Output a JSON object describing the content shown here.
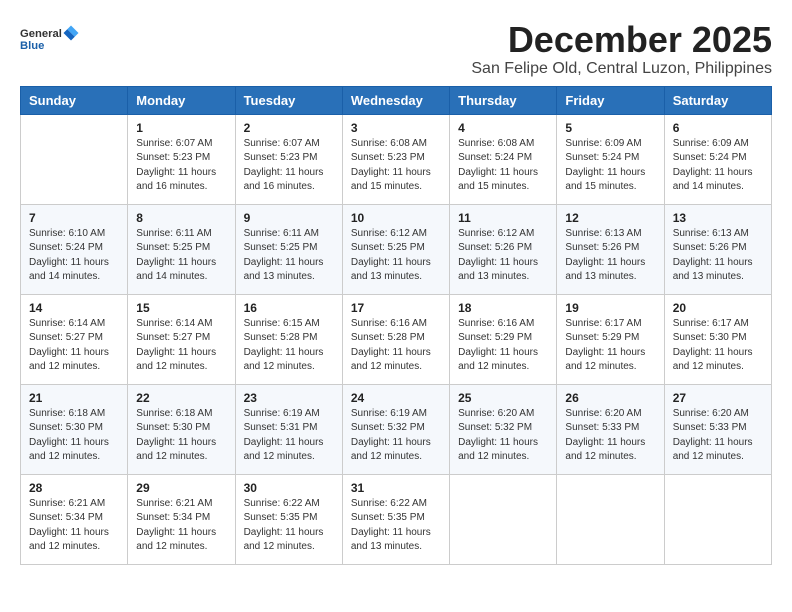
{
  "header": {
    "logo_line1": "General",
    "logo_line2": "Blue",
    "month": "December 2025",
    "location": "San Felipe Old, Central Luzon, Philippines"
  },
  "weekdays": [
    "Sunday",
    "Monday",
    "Tuesday",
    "Wednesday",
    "Thursday",
    "Friday",
    "Saturday"
  ],
  "weeks": [
    [
      {
        "day": "",
        "sunrise": "",
        "sunset": "",
        "daylight": ""
      },
      {
        "day": "1",
        "sunrise": "Sunrise: 6:07 AM",
        "sunset": "Sunset: 5:23 PM",
        "daylight": "Daylight: 11 hours and 16 minutes."
      },
      {
        "day": "2",
        "sunrise": "Sunrise: 6:07 AM",
        "sunset": "Sunset: 5:23 PM",
        "daylight": "Daylight: 11 hours and 16 minutes."
      },
      {
        "day": "3",
        "sunrise": "Sunrise: 6:08 AM",
        "sunset": "Sunset: 5:23 PM",
        "daylight": "Daylight: 11 hours and 15 minutes."
      },
      {
        "day": "4",
        "sunrise": "Sunrise: 6:08 AM",
        "sunset": "Sunset: 5:24 PM",
        "daylight": "Daylight: 11 hours and 15 minutes."
      },
      {
        "day": "5",
        "sunrise": "Sunrise: 6:09 AM",
        "sunset": "Sunset: 5:24 PM",
        "daylight": "Daylight: 11 hours and 15 minutes."
      },
      {
        "day": "6",
        "sunrise": "Sunrise: 6:09 AM",
        "sunset": "Sunset: 5:24 PM",
        "daylight": "Daylight: 11 hours and 14 minutes."
      }
    ],
    [
      {
        "day": "7",
        "sunrise": "Sunrise: 6:10 AM",
        "sunset": "Sunset: 5:24 PM",
        "daylight": "Daylight: 11 hours and 14 minutes."
      },
      {
        "day": "8",
        "sunrise": "Sunrise: 6:11 AM",
        "sunset": "Sunset: 5:25 PM",
        "daylight": "Daylight: 11 hours and 14 minutes."
      },
      {
        "day": "9",
        "sunrise": "Sunrise: 6:11 AM",
        "sunset": "Sunset: 5:25 PM",
        "daylight": "Daylight: 11 hours and 13 minutes."
      },
      {
        "day": "10",
        "sunrise": "Sunrise: 6:12 AM",
        "sunset": "Sunset: 5:25 PM",
        "daylight": "Daylight: 11 hours and 13 minutes."
      },
      {
        "day": "11",
        "sunrise": "Sunrise: 6:12 AM",
        "sunset": "Sunset: 5:26 PM",
        "daylight": "Daylight: 11 hours and 13 minutes."
      },
      {
        "day": "12",
        "sunrise": "Sunrise: 6:13 AM",
        "sunset": "Sunset: 5:26 PM",
        "daylight": "Daylight: 11 hours and 13 minutes."
      },
      {
        "day": "13",
        "sunrise": "Sunrise: 6:13 AM",
        "sunset": "Sunset: 5:26 PM",
        "daylight": "Daylight: 11 hours and 13 minutes."
      }
    ],
    [
      {
        "day": "14",
        "sunrise": "Sunrise: 6:14 AM",
        "sunset": "Sunset: 5:27 PM",
        "daylight": "Daylight: 11 hours and 12 minutes."
      },
      {
        "day": "15",
        "sunrise": "Sunrise: 6:14 AM",
        "sunset": "Sunset: 5:27 PM",
        "daylight": "Daylight: 11 hours and 12 minutes."
      },
      {
        "day": "16",
        "sunrise": "Sunrise: 6:15 AM",
        "sunset": "Sunset: 5:28 PM",
        "daylight": "Daylight: 11 hours and 12 minutes."
      },
      {
        "day": "17",
        "sunrise": "Sunrise: 6:16 AM",
        "sunset": "Sunset: 5:28 PM",
        "daylight": "Daylight: 11 hours and 12 minutes."
      },
      {
        "day": "18",
        "sunrise": "Sunrise: 6:16 AM",
        "sunset": "Sunset: 5:29 PM",
        "daylight": "Daylight: 11 hours and 12 minutes."
      },
      {
        "day": "19",
        "sunrise": "Sunrise: 6:17 AM",
        "sunset": "Sunset: 5:29 PM",
        "daylight": "Daylight: 11 hours and 12 minutes."
      },
      {
        "day": "20",
        "sunrise": "Sunrise: 6:17 AM",
        "sunset": "Sunset: 5:30 PM",
        "daylight": "Daylight: 11 hours and 12 minutes."
      }
    ],
    [
      {
        "day": "21",
        "sunrise": "Sunrise: 6:18 AM",
        "sunset": "Sunset: 5:30 PM",
        "daylight": "Daylight: 11 hours and 12 minutes."
      },
      {
        "day": "22",
        "sunrise": "Sunrise: 6:18 AM",
        "sunset": "Sunset: 5:30 PM",
        "daylight": "Daylight: 11 hours and 12 minutes."
      },
      {
        "day": "23",
        "sunrise": "Sunrise: 6:19 AM",
        "sunset": "Sunset: 5:31 PM",
        "daylight": "Daylight: 11 hours and 12 minutes."
      },
      {
        "day": "24",
        "sunrise": "Sunrise: 6:19 AM",
        "sunset": "Sunset: 5:32 PM",
        "daylight": "Daylight: 11 hours and 12 minutes."
      },
      {
        "day": "25",
        "sunrise": "Sunrise: 6:20 AM",
        "sunset": "Sunset: 5:32 PM",
        "daylight": "Daylight: 11 hours and 12 minutes."
      },
      {
        "day": "26",
        "sunrise": "Sunrise: 6:20 AM",
        "sunset": "Sunset: 5:33 PM",
        "daylight": "Daylight: 11 hours and 12 minutes."
      },
      {
        "day": "27",
        "sunrise": "Sunrise: 6:20 AM",
        "sunset": "Sunset: 5:33 PM",
        "daylight": "Daylight: 11 hours and 12 minutes."
      }
    ],
    [
      {
        "day": "28",
        "sunrise": "Sunrise: 6:21 AM",
        "sunset": "Sunset: 5:34 PM",
        "daylight": "Daylight: 11 hours and 12 minutes."
      },
      {
        "day": "29",
        "sunrise": "Sunrise: 6:21 AM",
        "sunset": "Sunset: 5:34 PM",
        "daylight": "Daylight: 11 hours and 12 minutes."
      },
      {
        "day": "30",
        "sunrise": "Sunrise: 6:22 AM",
        "sunset": "Sunset: 5:35 PM",
        "daylight": "Daylight: 11 hours and 12 minutes."
      },
      {
        "day": "31",
        "sunrise": "Sunrise: 6:22 AM",
        "sunset": "Sunset: 5:35 PM",
        "daylight": "Daylight: 11 hours and 13 minutes."
      },
      {
        "day": "",
        "sunrise": "",
        "sunset": "",
        "daylight": ""
      },
      {
        "day": "",
        "sunrise": "",
        "sunset": "",
        "daylight": ""
      },
      {
        "day": "",
        "sunrise": "",
        "sunset": "",
        "daylight": ""
      }
    ]
  ]
}
